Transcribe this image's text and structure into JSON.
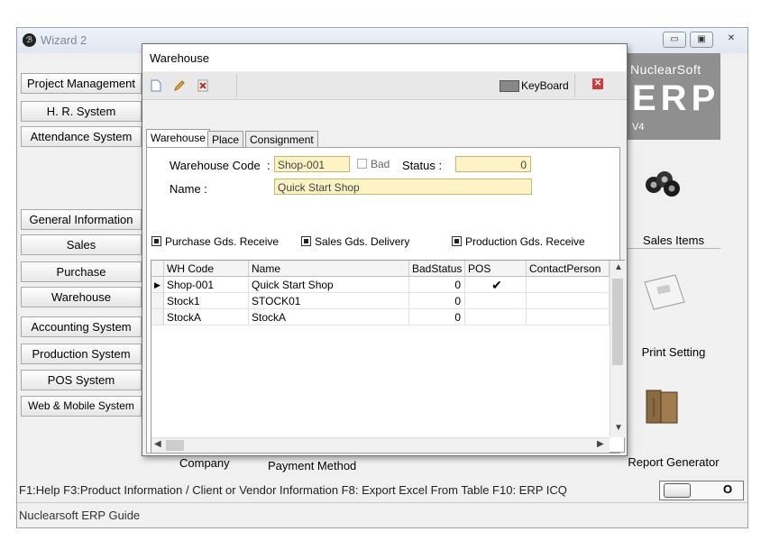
{
  "wizard": {
    "title": "Wizard 2",
    "logo": "ℬ",
    "window_buttons": [
      "▭",
      "▣",
      "✕"
    ]
  },
  "menu": {
    "items": [
      "Project Management",
      "H. R. System",
      "Attendance System",
      "General Information",
      "Sales",
      "Purchase",
      "Warehouse",
      "Accounting System",
      "Production System",
      "POS System",
      "Web & Mobile System"
    ]
  },
  "brand": {
    "name": "NuclearSoft",
    "product": "ERP",
    "version": "V4"
  },
  "right_panel": {
    "sales_items": "Sales Items",
    "print_setting": "Print Setting",
    "report_generator": "Report Generator"
  },
  "bottom": {
    "company": "Company",
    "payment_method": "Payment Method",
    "fkeys": "F1:Help  F3:Product Information / Client or Vendor Information  F8: Export Excel From Table  F10: ERP ICQ",
    "guide": "Nuclearsoft ERP Guide",
    "toggle_text": "O"
  },
  "dialog": {
    "title": "Warehouse",
    "keyboard_label": "KeyBoard",
    "close_glyph": "✕",
    "tabs": [
      "Warehouse",
      "Place",
      "Consignment"
    ],
    "form": {
      "code_label": "Warehouse Code",
      "code_colon": ":",
      "code_value": "Shop-001",
      "bad_label": "Bad",
      "status_label": "Status :",
      "status_value": "0",
      "name_label": "Name :",
      "name_value": "Quick Start Shop"
    },
    "checkboxes": [
      "Purchase Gds. Receive",
      "Sales Gds. Delivery",
      "Production Gds. Receive"
    ],
    "grid": {
      "columns": [
        "WH Code",
        "Name",
        "BadStatus",
        "POS",
        "ContactPerson"
      ],
      "rows": [
        {
          "code": "Shop-001",
          "name": "Quick Start Shop",
          "bad": "0",
          "pos": "✔",
          "contact": ""
        },
        {
          "code": "Stock1",
          "name": "STOCK01",
          "bad": "0",
          "pos": "",
          "contact": ""
        },
        {
          "code": "StockA",
          "name": "StockA",
          "bad": "0",
          "pos": "",
          "contact": ""
        }
      ],
      "current_row_marker": "▶"
    }
  }
}
